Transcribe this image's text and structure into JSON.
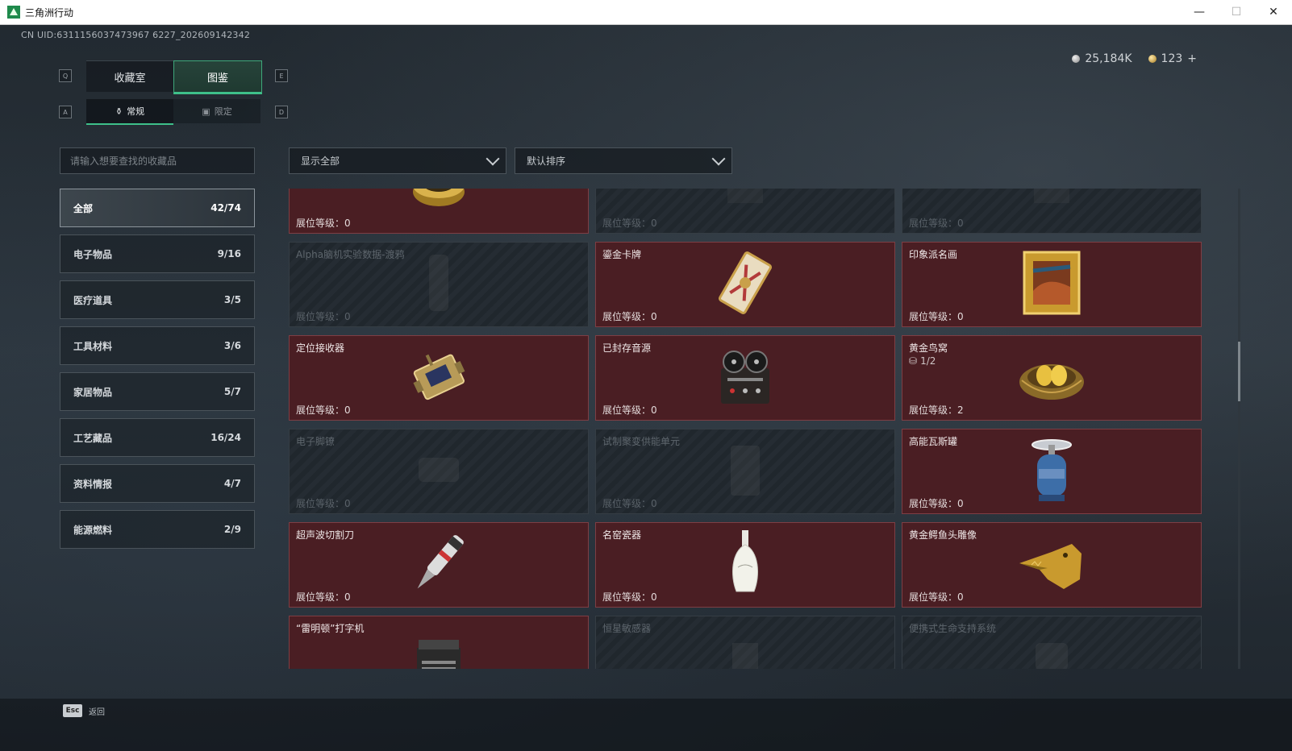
{
  "window": {
    "title": "三角洲行动",
    "minimize": "—",
    "maximize": "☐",
    "close": "✕"
  },
  "header": {
    "uid": "CN UID:6311156037473967 6227_202609142342",
    "currency_silver": "25,184K",
    "currency_gold": "123",
    "currency_add": "+"
  },
  "tabs": {
    "left_key": "Q",
    "right_key": "E",
    "items": [
      "收藏室",
      "图鉴"
    ],
    "active": "图鉴"
  },
  "subtabs": {
    "left_key": "A",
    "right_key": "D",
    "items": [
      "常规",
      "限定"
    ],
    "active": "常规"
  },
  "search": {
    "placeholder": "请输入想要查找的收藏品"
  },
  "filters": {
    "show": "显示全部",
    "sort": "默认排序"
  },
  "categories": [
    {
      "label": "全部",
      "count": "42/74"
    },
    {
      "label": "电子物品",
      "count": "9/16"
    },
    {
      "label": "医疗道具",
      "count": "3/5"
    },
    {
      "label": "工具材料",
      "count": "3/6"
    },
    {
      "label": "家居物品",
      "count": "5/7"
    },
    {
      "label": "工艺藏品",
      "count": "16/24"
    },
    {
      "label": "资料情报",
      "count": "4/7"
    },
    {
      "label": "能源燃料",
      "count": "2/9"
    }
  ],
  "cards": [
    {
      "name": "",
      "level": "展位等级：0",
      "owned": true,
      "icon": "caviar-tin-icon"
    },
    {
      "name": "",
      "level": "展位等级：0",
      "owned": false,
      "icon": "unknown-icon"
    },
    {
      "name": "",
      "level": "展位等级：0",
      "owned": false,
      "icon": "unknown-icon"
    },
    {
      "name": "Alpha脑机实验数据-渡鸦",
      "level": "展位等级：0",
      "owned": false,
      "icon": "data-device-icon"
    },
    {
      "name": "鎏金卡牌",
      "level": "展位等级：0",
      "owned": true,
      "icon": "gilded-card-icon"
    },
    {
      "name": "印象派名画",
      "level": "展位等级：0",
      "owned": true,
      "icon": "framed-painting-icon"
    },
    {
      "name": "定位接收器",
      "level": "展位等级：0",
      "owned": true,
      "icon": "gps-receiver-icon"
    },
    {
      "name": "已封存音源",
      "level": "展位等级：0",
      "owned": true,
      "icon": "reel-recorder-icon"
    },
    {
      "name": "黄金鸟窝",
      "level": "展位等级：2",
      "owned": true,
      "icon": "golden-nest-icon",
      "count": "1/2"
    },
    {
      "name": "电子脚镣",
      "level": "展位等级：0",
      "owned": false,
      "icon": "ankle-monitor-icon"
    },
    {
      "name": "试制聚变供能单元",
      "level": "展位等级：0",
      "owned": false,
      "icon": "fusion-unit-icon"
    },
    {
      "name": "高能瓦斯罐",
      "level": "展位等级：0",
      "owned": true,
      "icon": "gas-canister-icon"
    },
    {
      "name": "超声波切割刀",
      "level": "展位等级：0",
      "owned": true,
      "icon": "ultrasonic-cutter-icon"
    },
    {
      "name": "名窑瓷器",
      "level": "展位等级：0",
      "owned": true,
      "icon": "porcelain-vase-icon"
    },
    {
      "name": "黄金鳄鱼头雕像",
      "level": "展位等级：0",
      "owned": true,
      "icon": "gold-crocodile-icon"
    },
    {
      "name": "“雷明顿”打字机",
      "level": "",
      "owned": true,
      "icon": "typewriter-icon"
    },
    {
      "name": "恒星敏感器",
      "level": "",
      "owned": false,
      "icon": "star-sensor-icon"
    },
    {
      "name": "便携式生命支持系统",
      "level": "",
      "owned": false,
      "icon": "life-support-icon"
    }
  ],
  "footer": {
    "esc_key": "Esc",
    "back_label": "返回"
  },
  "colors": {
    "accent": "#3ec08a",
    "owned_card": "#4a1e23",
    "locked_card": "#20272d"
  }
}
